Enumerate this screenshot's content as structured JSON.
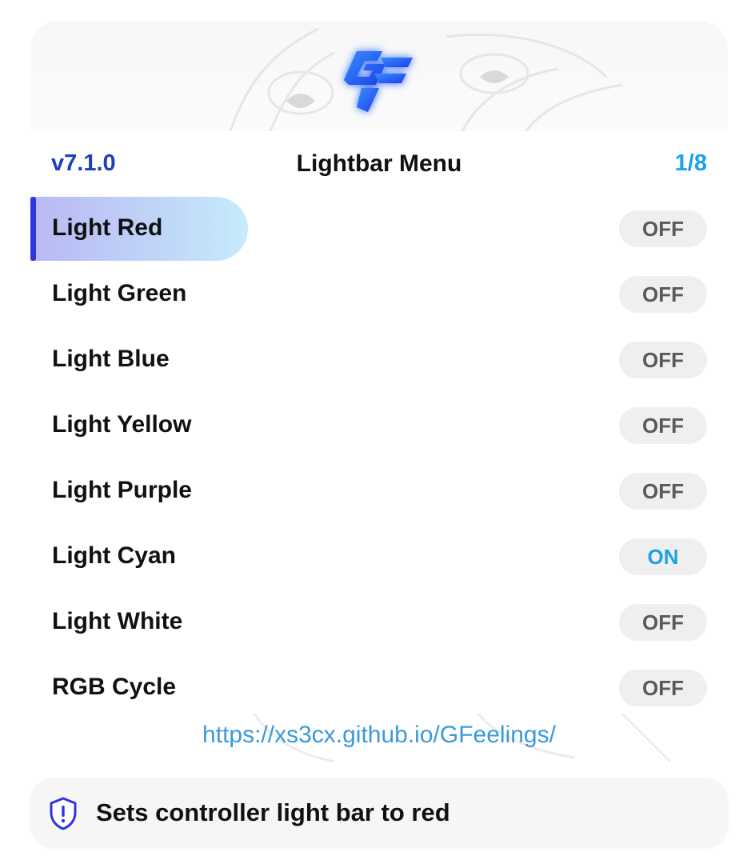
{
  "header": {
    "version": "v7.1.0",
    "title": "Lightbar Menu",
    "page_indicator": "1/8"
  },
  "menu": {
    "items": [
      {
        "label": "Light Red",
        "state": "OFF",
        "selected": true
      },
      {
        "label": "Light Green",
        "state": "OFF",
        "selected": false
      },
      {
        "label": "Light Blue",
        "state": "OFF",
        "selected": false
      },
      {
        "label": "Light Yellow",
        "state": "OFF",
        "selected": false
      },
      {
        "label": "Light Purple",
        "state": "OFF",
        "selected": false
      },
      {
        "label": "Light Cyan",
        "state": "ON",
        "selected": false
      },
      {
        "label": "Light White",
        "state": "OFF",
        "selected": false
      },
      {
        "label": "RGB Cycle",
        "state": "OFF",
        "selected": false
      }
    ]
  },
  "footer": {
    "url": "https://xs3cx.github.io/GFeelings/"
  },
  "description": {
    "icon": "shield-exclamation-icon",
    "text": "Sets controller light bar to red"
  },
  "colors": {
    "accent": "#2d34e0",
    "version": "#1f3fb8",
    "on_state": "#1aa3e8",
    "off_state": "#5a5a5a"
  }
}
